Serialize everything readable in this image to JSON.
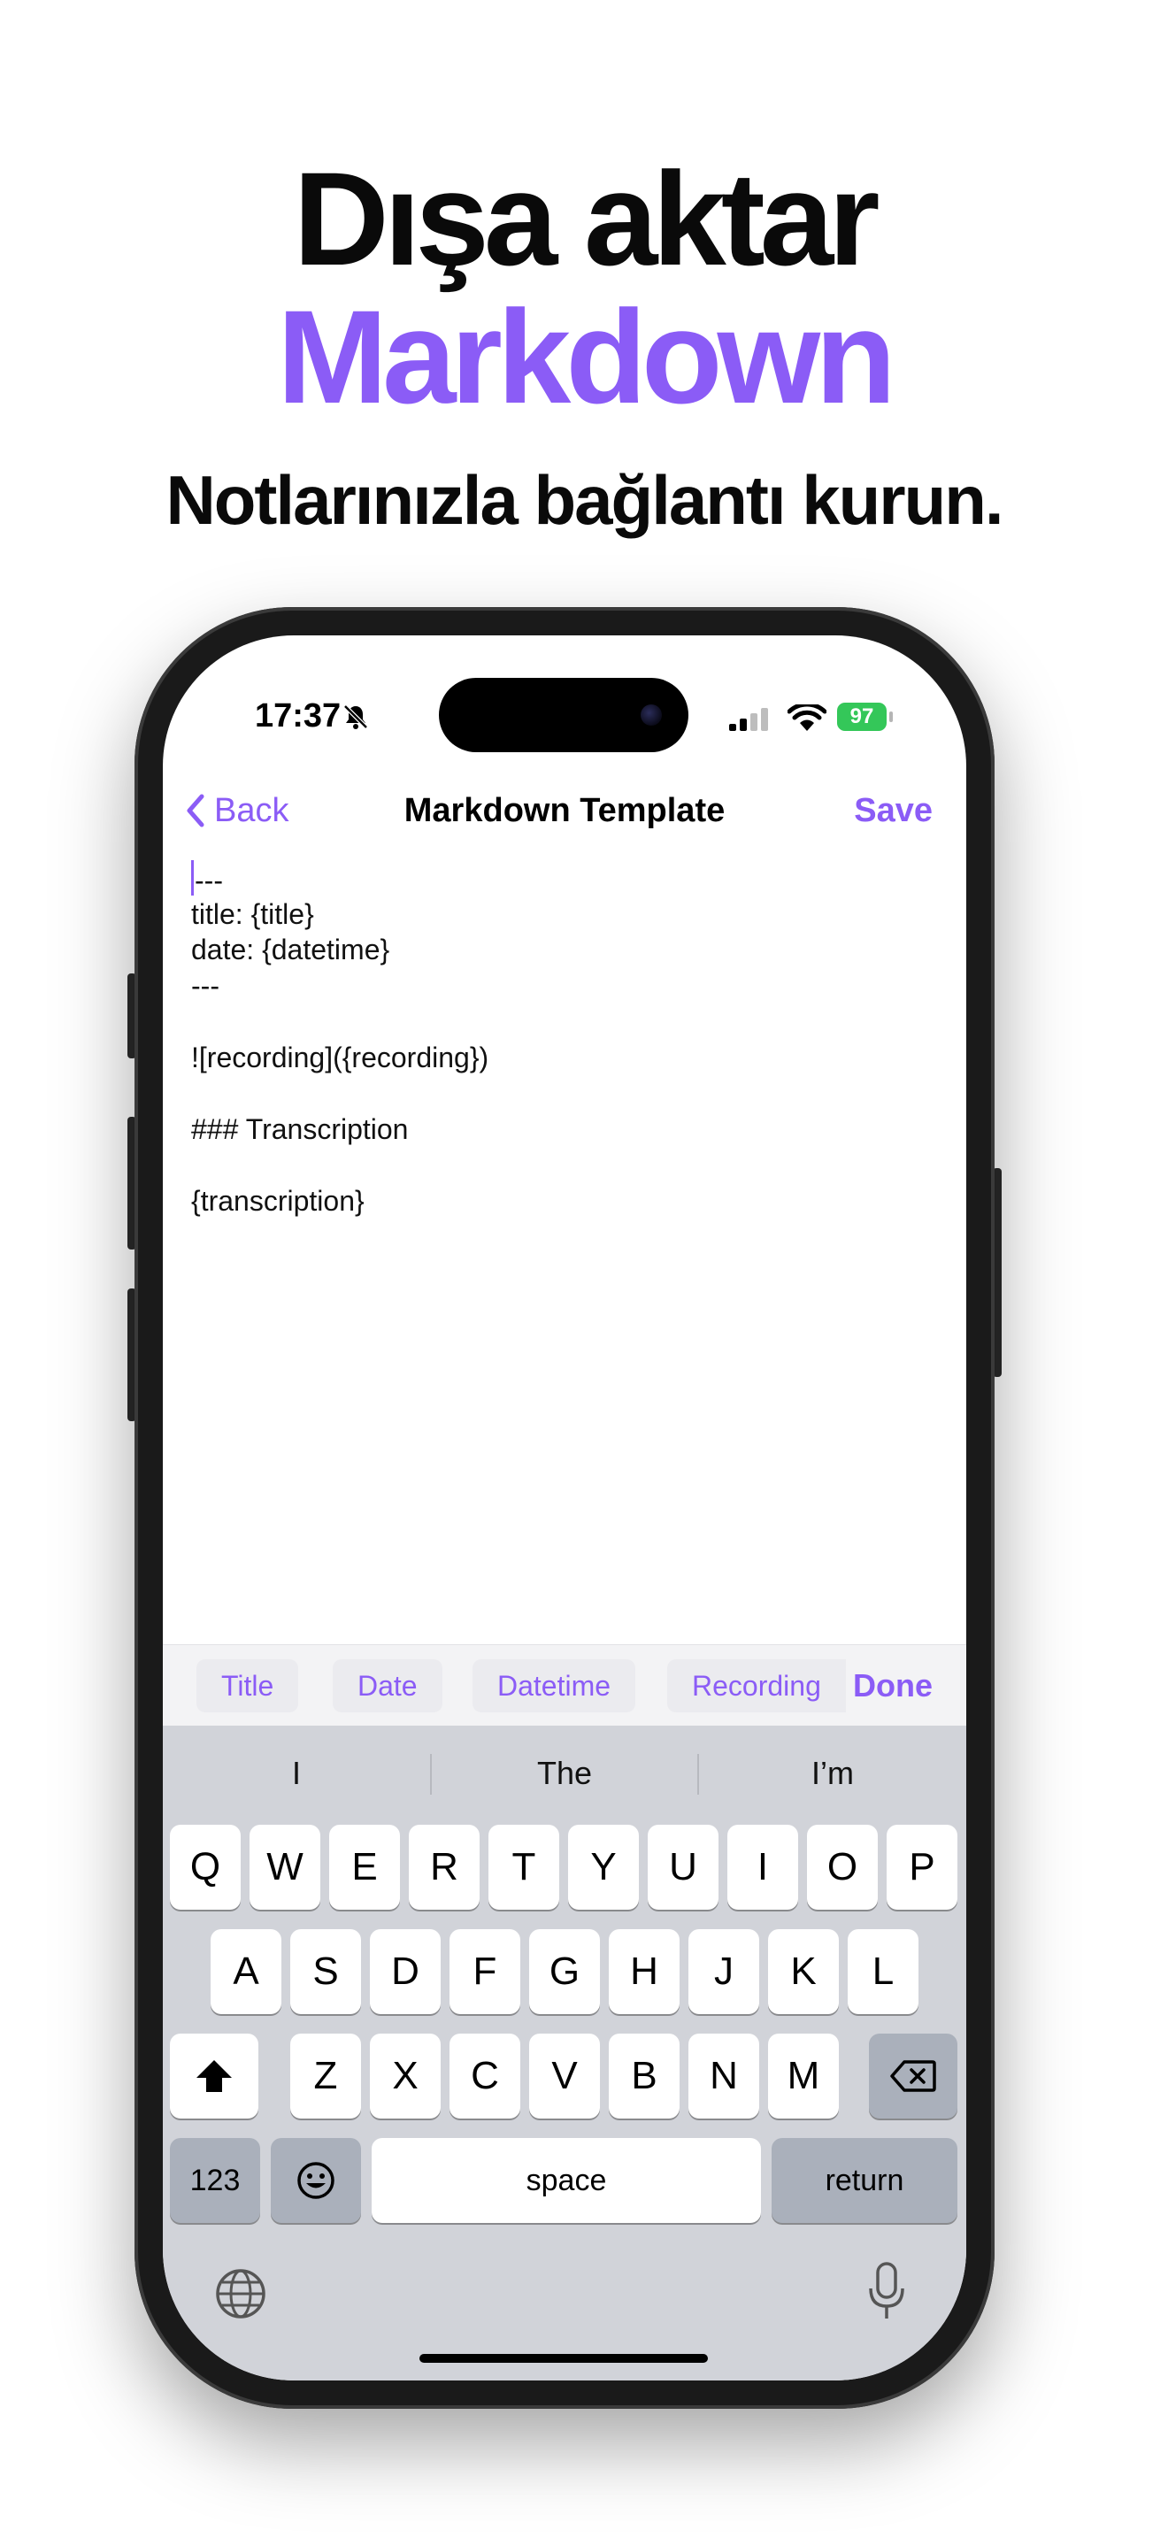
{
  "promo": {
    "headline1": "Dışa aktar",
    "headline2": "Markdown",
    "subtitle": "Notlarınızla bağlantı kurun."
  },
  "status_bar": {
    "time": "17:37",
    "battery": "97"
  },
  "nav": {
    "back_label": "Back",
    "title": "Markdown Template",
    "save_label": "Save"
  },
  "editor": {
    "lines": [
      "---",
      "title: {title}",
      "date: {datetime}",
      "---",
      "",
      "![recording]({recording})",
      "",
      "### Transcription",
      "",
      "{transcription}"
    ]
  },
  "accessory_bar": {
    "chips": [
      "Title",
      "Date",
      "Datetime",
      "Recording"
    ],
    "done_label": "Done"
  },
  "keyboard": {
    "suggestions": [
      "I",
      "The",
      "I’m"
    ],
    "row1": [
      "Q",
      "W",
      "E",
      "R",
      "T",
      "Y",
      "U",
      "I",
      "O",
      "P"
    ],
    "row2": [
      "A",
      "S",
      "D",
      "F",
      "G",
      "H",
      "J",
      "K",
      "L"
    ],
    "row3": [
      "Z",
      "X",
      "C",
      "V",
      "B",
      "N",
      "M"
    ],
    "numbers_key": "123",
    "space_key": "space",
    "return_key": "return"
  },
  "colors": {
    "accent": "#8b5cf6",
    "keyboard_bg": "#d1d3d9",
    "battery": "#34c759"
  }
}
